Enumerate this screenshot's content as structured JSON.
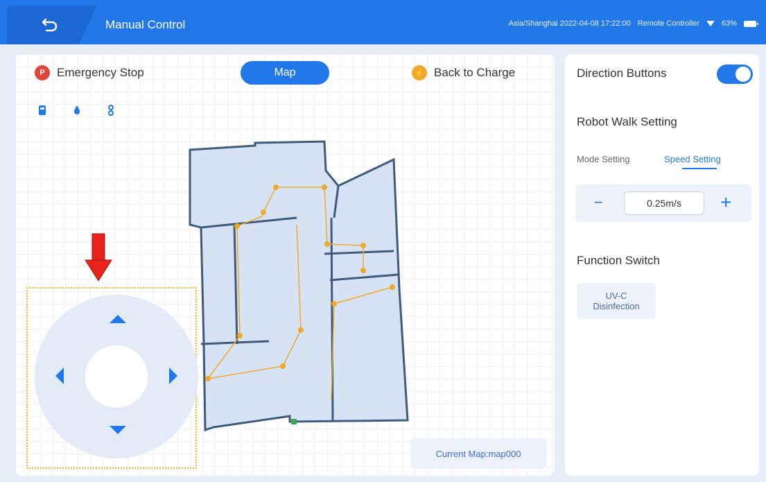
{
  "header": {
    "title": "Manual Control",
    "timezone_time": "Asia/Shanghai 2022-04-08 17:22:00",
    "controller": "Remote Controller",
    "battery": "63%"
  },
  "left": {
    "emergency_stop": "Emergency Stop",
    "emergency_icon_text": "P",
    "map_button": "Map",
    "back_to_charge": "Back to Charge",
    "current_map": "Current Map:map000"
  },
  "right": {
    "direction_buttons": "Direction Buttons",
    "robot_walk_setting": "Robot Walk Setting",
    "tabs": [
      "Mode Setting",
      "Speed Setting"
    ],
    "speed_value": "0.25m/s",
    "minus": "−",
    "plus": "+",
    "function_switch": "Function Switch",
    "uvc_line1": "UV-C",
    "uvc_line2": "Disinfection"
  },
  "colors": {
    "accent": "#2378e8",
    "emergency": "#e2453c",
    "charge": "#f0a92a",
    "path": "#f0a92a"
  },
  "icons": [
    "back-icon",
    "wifi-icon",
    "battery-icon",
    "robot-icon",
    "water-drop-icon",
    "sensor-icon"
  ]
}
